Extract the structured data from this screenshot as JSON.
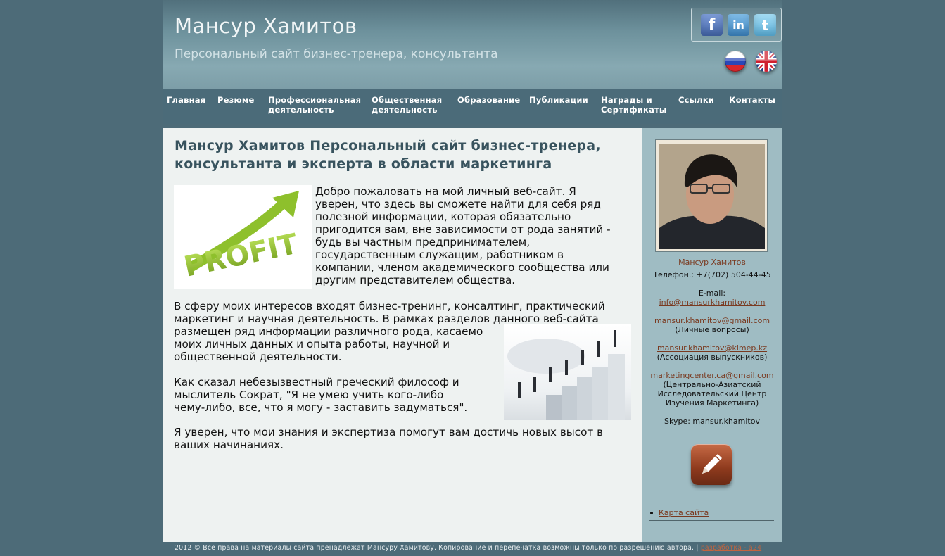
{
  "header": {
    "title": "Мансур Хамитов",
    "subtitle": "Персональный сайт бизнес-тренера, консультанта",
    "social": {
      "facebook": "f",
      "linkedin": "in",
      "twitter": "t"
    }
  },
  "nav": {
    "items": [
      {
        "line1": "Главная",
        "line2": ""
      },
      {
        "line1": "Резюме",
        "line2": ""
      },
      {
        "line1": "Профессиональная",
        "line2": "деятельность"
      },
      {
        "line1": "Общественная",
        "line2": "деятельность"
      },
      {
        "line1": "Образование",
        "line2": ""
      },
      {
        "line1": "Публикации",
        "line2": ""
      },
      {
        "line1": "Награды и",
        "line2": "Сертификаты"
      },
      {
        "line1": "Ссылки",
        "line2": ""
      },
      {
        "line1": "Контакты",
        "line2": ""
      }
    ]
  },
  "main": {
    "heading_line1": "Мансур Хамитов Персональный сайт бизнес-тренера,",
    "heading_line2": "консультанта и эксперта в области маркетинга",
    "p1": [
      "Добро пожаловать на мой личный веб-сайт. Я",
      "уверен, что здесь вы сможете найти для себя ряд",
      "полезной информации, которая обязательно",
      "пригодится вам, вне зависимости от рода занятий -",
      "будь вы частным предпринимателем,",
      "государственным служащим, работником в",
      "компании, членом академического сообщества или",
      "другим представителем общества."
    ],
    "p2": [
      "В сферу моих интересов входят бизнес-тренинг, консалтинг, практический",
      "маркетинг и научная деятельность. В рамках разделов  данного веб-сайта",
      "размещен ряд информации различного рода, касаемо",
      "моих личных данных и опыта работы, научной и",
      "общественной деятельности."
    ],
    "p3": [
      "Как сказал небезызвестный греческий философ и",
      "мыслитель Сократ, \"Я не умею учить кого-либо",
      "чему-либо, все, что я могу - заставить задуматься\"."
    ],
    "p4": [
      "Я уверен, что мои знания и экспертиза помогут вам достичь новых высот в",
      "ваших начинаниях."
    ],
    "profit_image_text": "PROFIT"
  },
  "sidebar": {
    "name": "Мансур Хамитов",
    "phone": "Телефон.: +7(702) 504-44-45",
    "email_label": "E-mail:",
    "emails": [
      {
        "address": "info@mansurkhamitov.com",
        "note": ""
      },
      {
        "address": "mansur.khamitov@gmail.com",
        "note": "(Личные вопросы)"
      },
      {
        "address": "mansur.khamitov@kimep.kz",
        "note": "(Ассоциация выпускников)"
      },
      {
        "address": "marketingcenter.ca@gmail.com",
        "note_lines": [
          "(Центрально-Азиатский",
          "Исследовательский Центр",
          "Изучения Маркетинга)"
        ]
      }
    ],
    "skype": "Skype: mansur.khamitov",
    "sitemap": "Карта сайта"
  },
  "footer": {
    "text": "2012 © Все права на материалы сайта пренадлежат Мансуру Хамитову. Копирование и перепечатка возможны только по разрешению автора. | ",
    "link": "разработка - a24"
  },
  "colors": {
    "background": "#4d6b78",
    "header": "#7d9ea8",
    "nav": "#4b6b79",
    "main": "#eef2f1",
    "sidebar": "#9fbcc3",
    "heading": "#38535e",
    "link": "#7a3a20"
  },
  "icons": [
    "facebook-icon",
    "linkedin-icon",
    "twitter-icon",
    "russian-flag-icon",
    "english-flag-icon",
    "pencil-icon"
  ]
}
